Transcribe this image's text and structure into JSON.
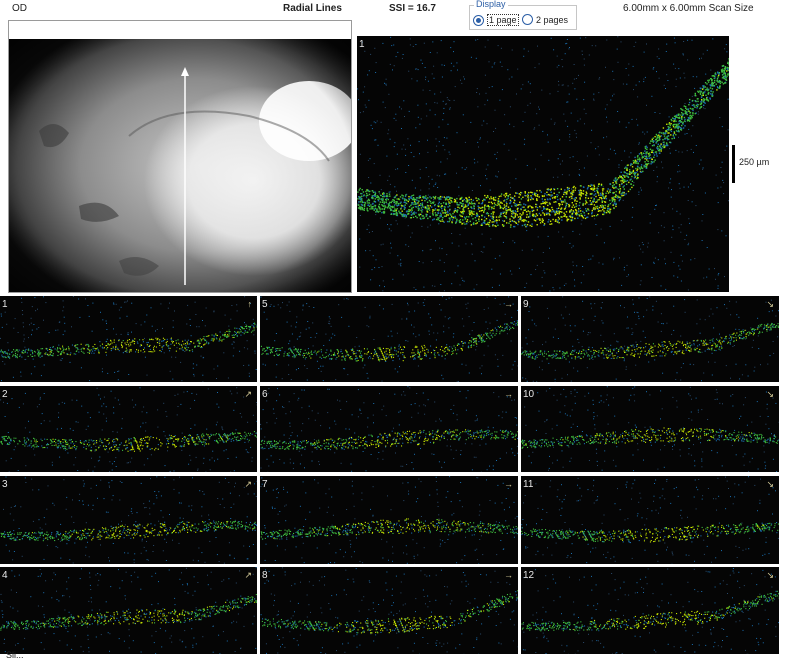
{
  "header": {
    "eye": "OD",
    "scan_type": "Radial Lines",
    "ssi": "SSI = 16.7",
    "scan_size": "6.00mm x 6.00mm Scan Size"
  },
  "display": {
    "legend": "Display",
    "options": [
      {
        "label": "1 page",
        "selected": true
      },
      {
        "label": "2 pages",
        "selected": false
      }
    ]
  },
  "main_scan": {
    "number": "1",
    "scale_label": "250 µm"
  },
  "thumbnails": [
    {
      "number": "1",
      "indicator": "↑"
    },
    {
      "number": "2",
      "indicator": "↗"
    },
    {
      "number": "3",
      "indicator": "↗"
    },
    {
      "number": "4",
      "indicator": "↗"
    },
    {
      "number": "5",
      "indicator": "→"
    },
    {
      "number": "6",
      "indicator": "→"
    },
    {
      "number": "7",
      "indicator": "→"
    },
    {
      "number": "8",
      "indicator": "→"
    },
    {
      "number": "9",
      "indicator": "↘"
    },
    {
      "number": "10",
      "indicator": "↘"
    },
    {
      "number": "11",
      "indicator": "↘"
    },
    {
      "number": "12",
      "indicator": "↘"
    }
  ],
  "footer": {
    "text": "Sli..."
  },
  "colors": {
    "oct_bright": "#c8e600",
    "oct_mid": "#3fbf3f",
    "oct_dim": "#1a6fb0",
    "background": "#050505"
  }
}
